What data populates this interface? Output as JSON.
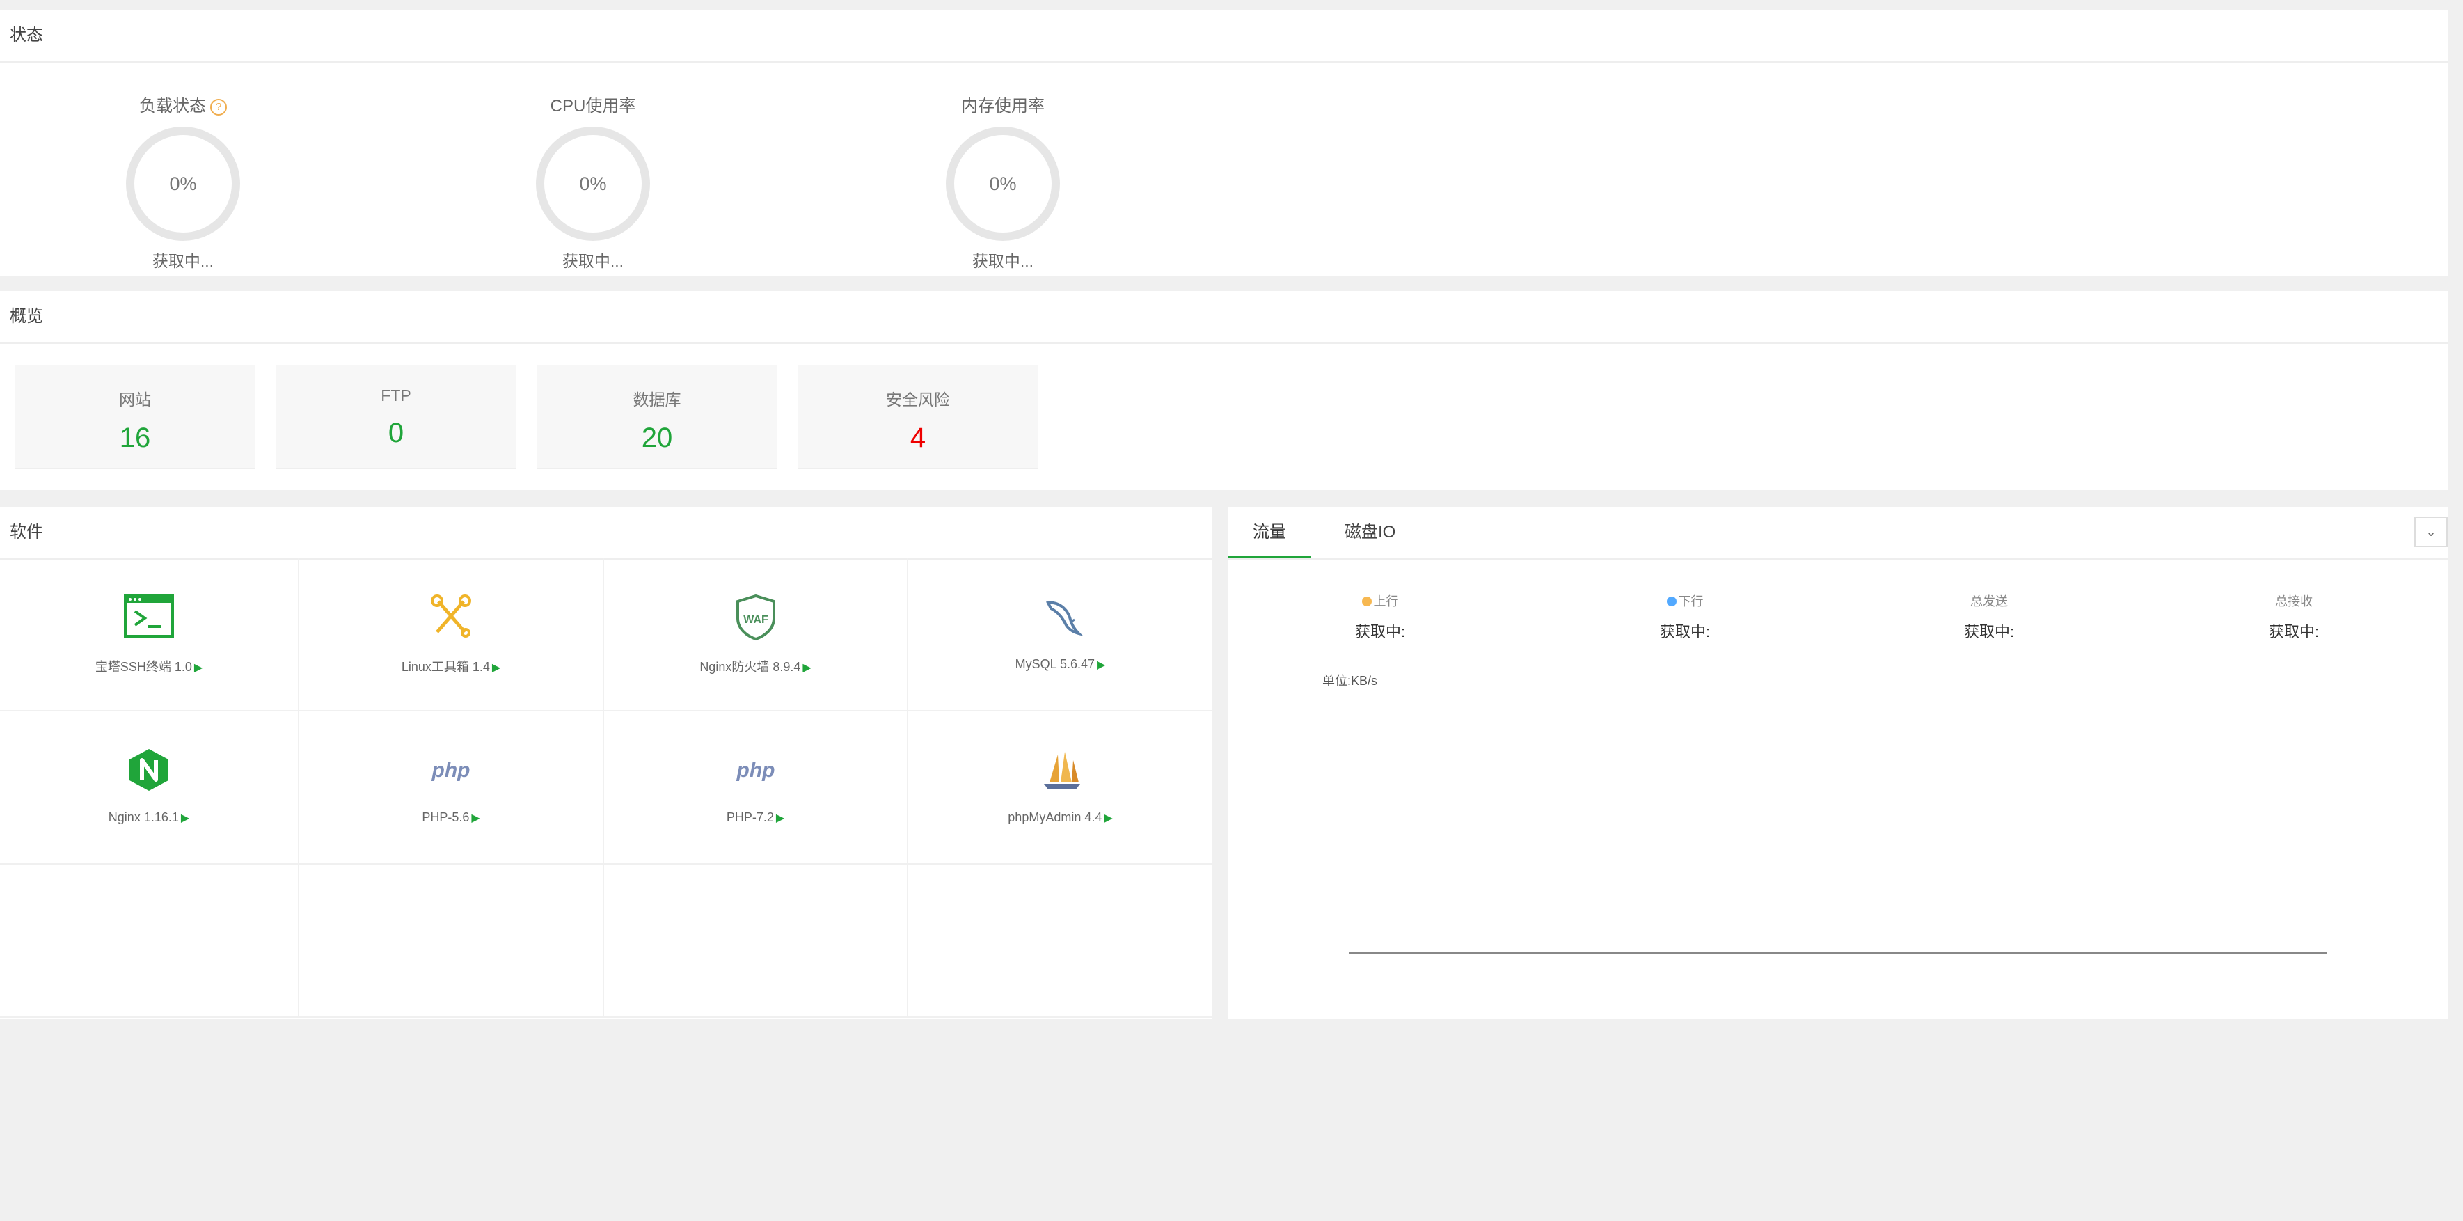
{
  "status": {
    "title": "状态",
    "gauges": [
      {
        "title": "负载状态",
        "value": "0%",
        "status": "获取中..."
      },
      {
        "title": "CPU使用率",
        "value": "0%",
        "status": "获取中..."
      },
      {
        "title": "内存使用率",
        "value": "0%",
        "status": "获取中..."
      }
    ],
    "help_icon": "?"
  },
  "overview": {
    "title": "概览",
    "cards": [
      {
        "label": "网站",
        "value": "16"
      },
      {
        "label": "FTP",
        "value": "0"
      },
      {
        "label": "数据库",
        "value": "20"
      },
      {
        "label": "安全风险",
        "value": "4"
      }
    ]
  },
  "software": {
    "title": "软件",
    "items": [
      {
        "label": "宝塔SSH终端 1.0",
        "icon": "terminal-icon"
      },
      {
        "label": "Linux工具箱 1.4",
        "icon": "tools-icon"
      },
      {
        "label": "Nginx防火墙 8.9.4",
        "icon": "waf-shield-icon"
      },
      {
        "label": "MySQL 5.6.47",
        "icon": "mysql-dolphin-icon"
      },
      {
        "label": "Nginx 1.16.1",
        "icon": "nginx-icon"
      },
      {
        "label": "PHP-5.6",
        "icon": "php-icon"
      },
      {
        "label": "PHP-7.2",
        "icon": "php-icon"
      },
      {
        "label": "phpMyAdmin 4.4",
        "icon": "phpmyadmin-icon"
      }
    ],
    "play_glyph": "▶"
  },
  "traffic": {
    "tabs": [
      "流量",
      "磁盘IO"
    ],
    "dropdown_glyph": "⌄",
    "stats": [
      {
        "label": "上行",
        "value": "获取中:",
        "dot_color": "#f7b851"
      },
      {
        "label": "下行",
        "value": "获取中:",
        "dot_color": "#52a9ff"
      },
      {
        "label": "总发送",
        "value": "获取中:"
      },
      {
        "label": "总接收",
        "value": "获取中:"
      }
    ],
    "unit": "单位:KB/s"
  },
  "colors": {
    "accent": "#20a53a",
    "danger": "#ee0000",
    "warning": "#f0ad4e"
  }
}
